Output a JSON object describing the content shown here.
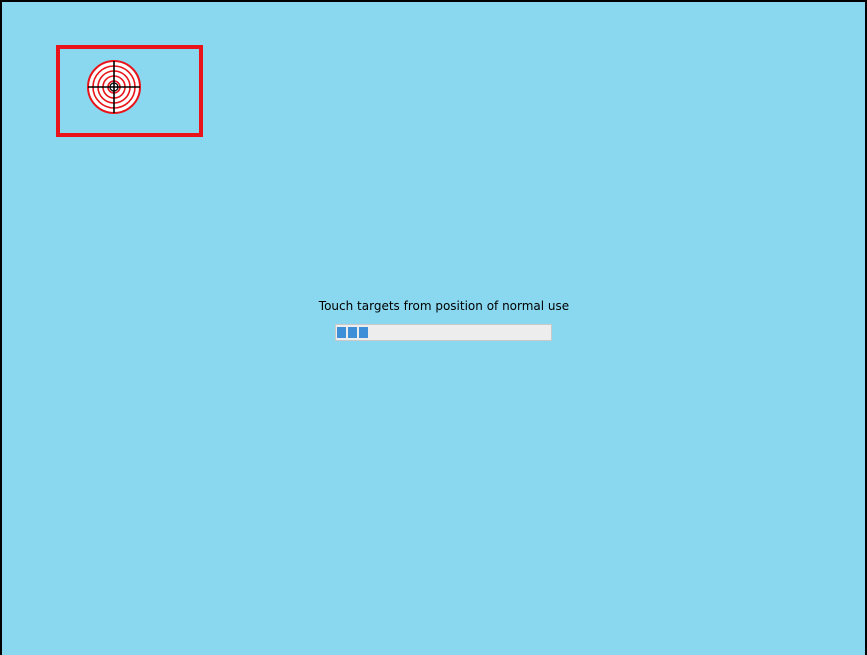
{
  "calibration": {
    "instruction": "Touch targets from position of normal use",
    "progress": {
      "segments_filled": 3,
      "segments_total": 22,
      "fill_color": "#3d8fd8"
    },
    "target_icon": "crosshair-target-icon",
    "highlight_color": "#e8141a",
    "background_color": "#8ad8f0"
  }
}
